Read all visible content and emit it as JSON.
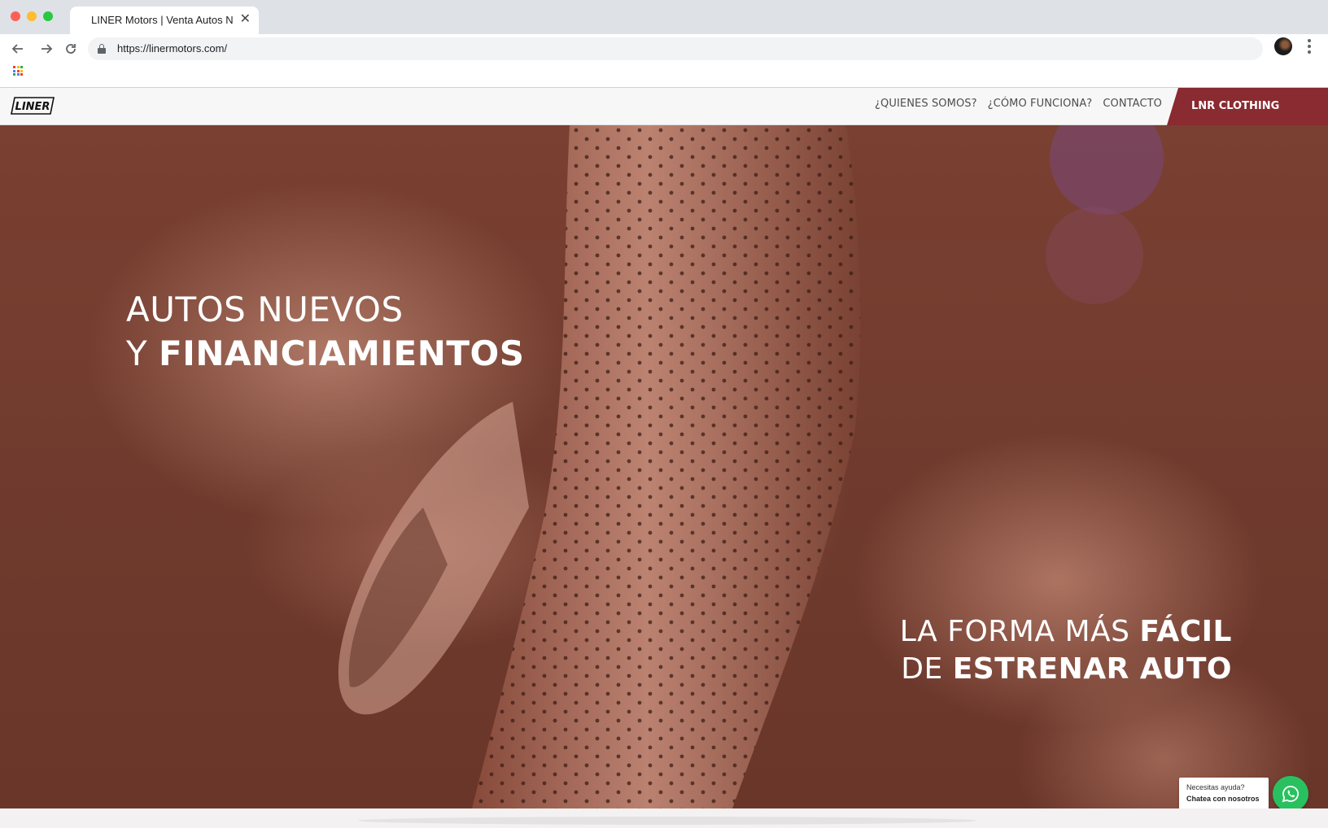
{
  "browser": {
    "tab_title": "LINER Motors | Venta Autos N",
    "tab_close": "✕",
    "url": "https://linermotors.com/",
    "back_icon": "arrow-left-icon",
    "forward_icon": "arrow-right-icon",
    "reload_icon": "reload-icon"
  },
  "site": {
    "logo_text": "LINER",
    "nav": [
      {
        "label": "¿QUIENES SOMOS?"
      },
      {
        "label": "¿CÓMO FUNCIONA?"
      },
      {
        "label": "CONTACTO"
      }
    ],
    "cta_label": "LNR CLOTHING",
    "brand_color": "#8a2a31"
  },
  "hero": {
    "title_line1": "AUTOS NUEVOS",
    "title_line2_prefix": "Y ",
    "title_line2_bold": "FINANCIAMIENTOS",
    "sub_line1_prefix": "LA FORMA MÁS ",
    "sub_line1_bold": "FÁCIL",
    "sub_line2_prefix": "DE ",
    "sub_line2_bold": "ESTRENAR AUTO"
  },
  "chat": {
    "line1": "Necesitas ayuda?",
    "line2": "Chatea con nosotros",
    "icon": "whatsapp-icon",
    "color": "#29c15f"
  }
}
